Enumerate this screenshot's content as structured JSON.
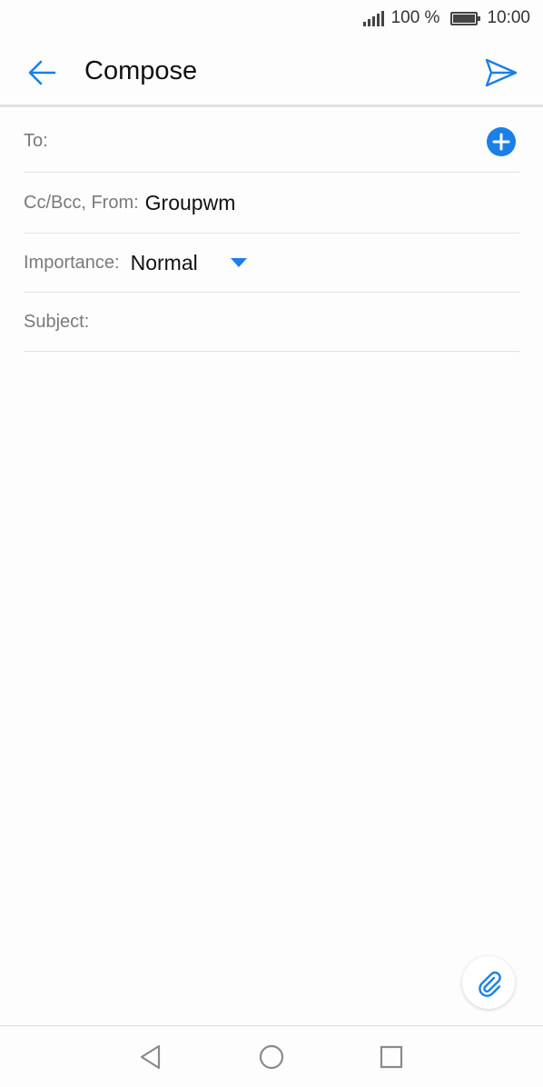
{
  "status_bar": {
    "battery_percent": "100 %",
    "time": "10:00"
  },
  "app_bar": {
    "title": "Compose",
    "back_icon": "arrow-left-icon",
    "send_icon": "send-icon"
  },
  "form": {
    "to_label": "To:",
    "to_value": "",
    "cc_from_label": "Cc/Bcc, From:",
    "from_value": "Groupwm",
    "importance_label": "Importance:",
    "importance_value": "Normal",
    "subject_label": "Subject:",
    "subject_value": ""
  },
  "nav_bar": {
    "back_icon": "nav-back-icon",
    "home_icon": "nav-home-icon",
    "recent_icon": "nav-recent-icon"
  },
  "colors": {
    "accent": "#1a7fe6",
    "background": "#fdfdfd",
    "divider": "#e3e3e3",
    "label": "#7a7a7a"
  }
}
